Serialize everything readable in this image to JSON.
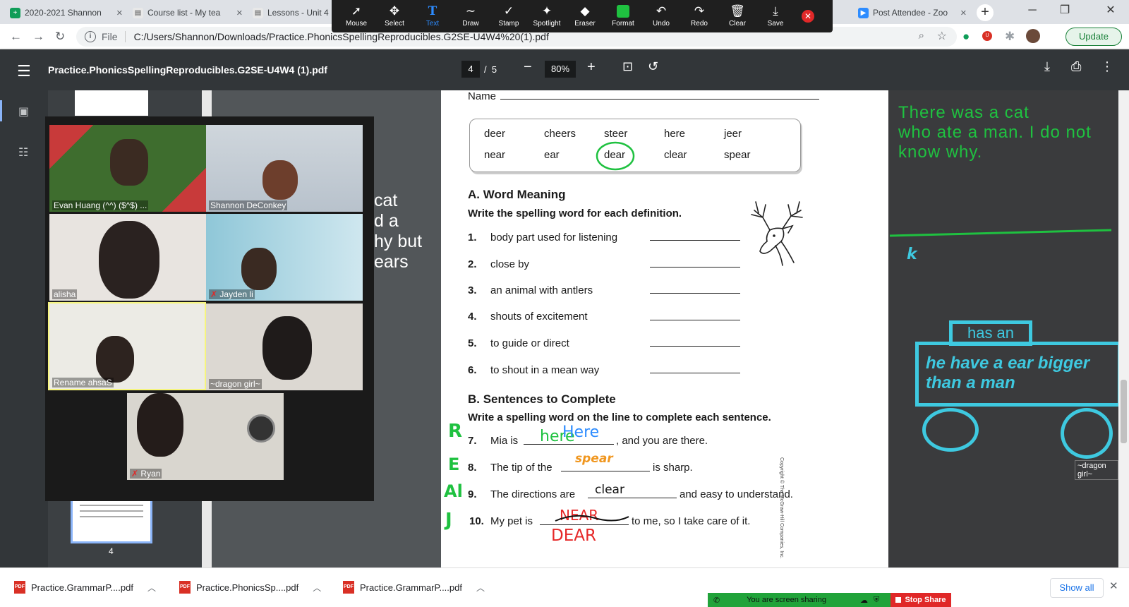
{
  "browser": {
    "tabs": [
      {
        "label": "2020-2021 Shannon",
        "favicon": "sheets-icon",
        "color": "#0f9d58"
      },
      {
        "label": "Course list - My tea",
        "favicon": "page-icon",
        "color": "#5f6368"
      },
      {
        "label": "Lessons - Unit 4",
        "favicon": "page-icon",
        "color": "#5f6368"
      },
      {
        "label": "Post Attendee - Zoo",
        "favicon": "zoom-icon",
        "color": "#2d8cff"
      }
    ],
    "new_tab": "+",
    "address": {
      "scheme_label": "File",
      "url": "C:/Users/Shannon/Downloads/Practice.PhonicsSpellingReproducibles.G2SE-U4W4%20(1).pdf"
    },
    "update_label": "Update"
  },
  "annotation_toolbar": {
    "tools": [
      {
        "label": "Mouse",
        "icon": "pointer-icon"
      },
      {
        "label": "Select",
        "icon": "move-icon"
      },
      {
        "label": "Text",
        "icon": "text-icon"
      },
      {
        "label": "Draw",
        "icon": "squiggle-icon"
      },
      {
        "label": "Stamp",
        "icon": "check-icon"
      },
      {
        "label": "Spotlight",
        "icon": "wand-icon"
      },
      {
        "label": "Eraser",
        "icon": "eraser-icon"
      },
      {
        "label": "Format",
        "icon": "swatch-icon"
      },
      {
        "label": "Undo",
        "icon": "undo-icon"
      },
      {
        "label": "Redo",
        "icon": "redo-icon"
      },
      {
        "label": "Clear",
        "icon": "trash-icon"
      },
      {
        "label": "Save",
        "icon": "save-icon"
      }
    ],
    "selected": "Text",
    "format_color": "#1fc140"
  },
  "pdf": {
    "filename": "Practice.PhonicsSpellingReproducibles.G2SE-U4W4 (1).pdf",
    "page_current": "4",
    "page_total": "5",
    "page_sep": "/",
    "zoom": "80%",
    "thumb_page_label": "4"
  },
  "worksheet": {
    "name_label": "Name",
    "word_bank": [
      [
        "deer",
        "cheers",
        "steer",
        "here",
        "jeer"
      ],
      [
        "near",
        "ear",
        "dear",
        "clear",
        "spear"
      ]
    ],
    "section_a_title": "A. Word Meaning",
    "section_a_instr": "Write the spelling word for each definition.",
    "definitions": [
      {
        "num": "1.",
        "text": "body part used for listening"
      },
      {
        "num": "2.",
        "text": "close by"
      },
      {
        "num": "3.",
        "text": "an animal with antlers"
      },
      {
        "num": "4.",
        "text": "shouts of excitement"
      },
      {
        "num": "5.",
        "text": "to guide or direct"
      },
      {
        "num": "6.",
        "text": "to shout in a mean way"
      }
    ],
    "section_b_title": "B. Sentences to Complete",
    "section_b_instr": "Write a spelling word on the line to complete each sentence.",
    "sentences": [
      {
        "num": "7.",
        "before": "Mia is",
        "after": ", and you are there."
      },
      {
        "num": "8.",
        "before": "The tip of the",
        "after": "is sharp."
      },
      {
        "num": "9.",
        "before": "The directions are",
        "after": "and easy to understand."
      },
      {
        "num": "10.",
        "before": "My pet is",
        "after": "to me, so I take care of it."
      }
    ],
    "copyright": "Copyright © The McGraw-Hill Companies, Inc."
  },
  "handwriting": {
    "ans7a": "here",
    "ans7b": "Here",
    "ans8": "spear",
    "ans9": "clear",
    "ans10a": "NEAR",
    "ans10b": "DEAR",
    "init7": "R",
    "init8": "E",
    "init9": "Al",
    "init10": "J",
    "green": "#1fc140",
    "blue": "#2d8cff",
    "orange": "#f0961e",
    "red": "#e62828",
    "cyan": "#3ec9e0"
  },
  "side_text": {
    "lines": [
      "cat",
      "d a",
      "hy but",
      "ears"
    ]
  },
  "whiteboard": {
    "green_text": [
      "There was a cat",
      "who ate a man. I do not",
      "know why."
    ],
    "k_mark": "k",
    "has_an": "has an",
    "box_text": [
      "he have a ear bigger",
      "than a man"
    ],
    "cursor_label": "~dragon girl~"
  },
  "gallery": {
    "participants": [
      {
        "name": "Evan Huang (^^) ($^$) ...",
        "muted": false
      },
      {
        "name": "Shannon DeConkey",
        "muted": false
      },
      {
        "name": "alisha",
        "muted": false
      },
      {
        "name": "Jayden li",
        "muted": true
      },
      {
        "name": "Rename ahsaS",
        "muted": false
      },
      {
        "name": "~dragon girl~",
        "muted": false
      },
      {
        "name": "Ryan",
        "muted": true
      }
    ]
  },
  "downloads": {
    "items": [
      "Practice.GrammarP....pdf",
      "Practice.PhonicsSp....pdf",
      "Practice.GrammarP....pdf"
    ],
    "show_all": "Show all"
  },
  "zoom_share": {
    "sharing_text": "You are screen sharing",
    "stop_label": "Stop Share"
  }
}
